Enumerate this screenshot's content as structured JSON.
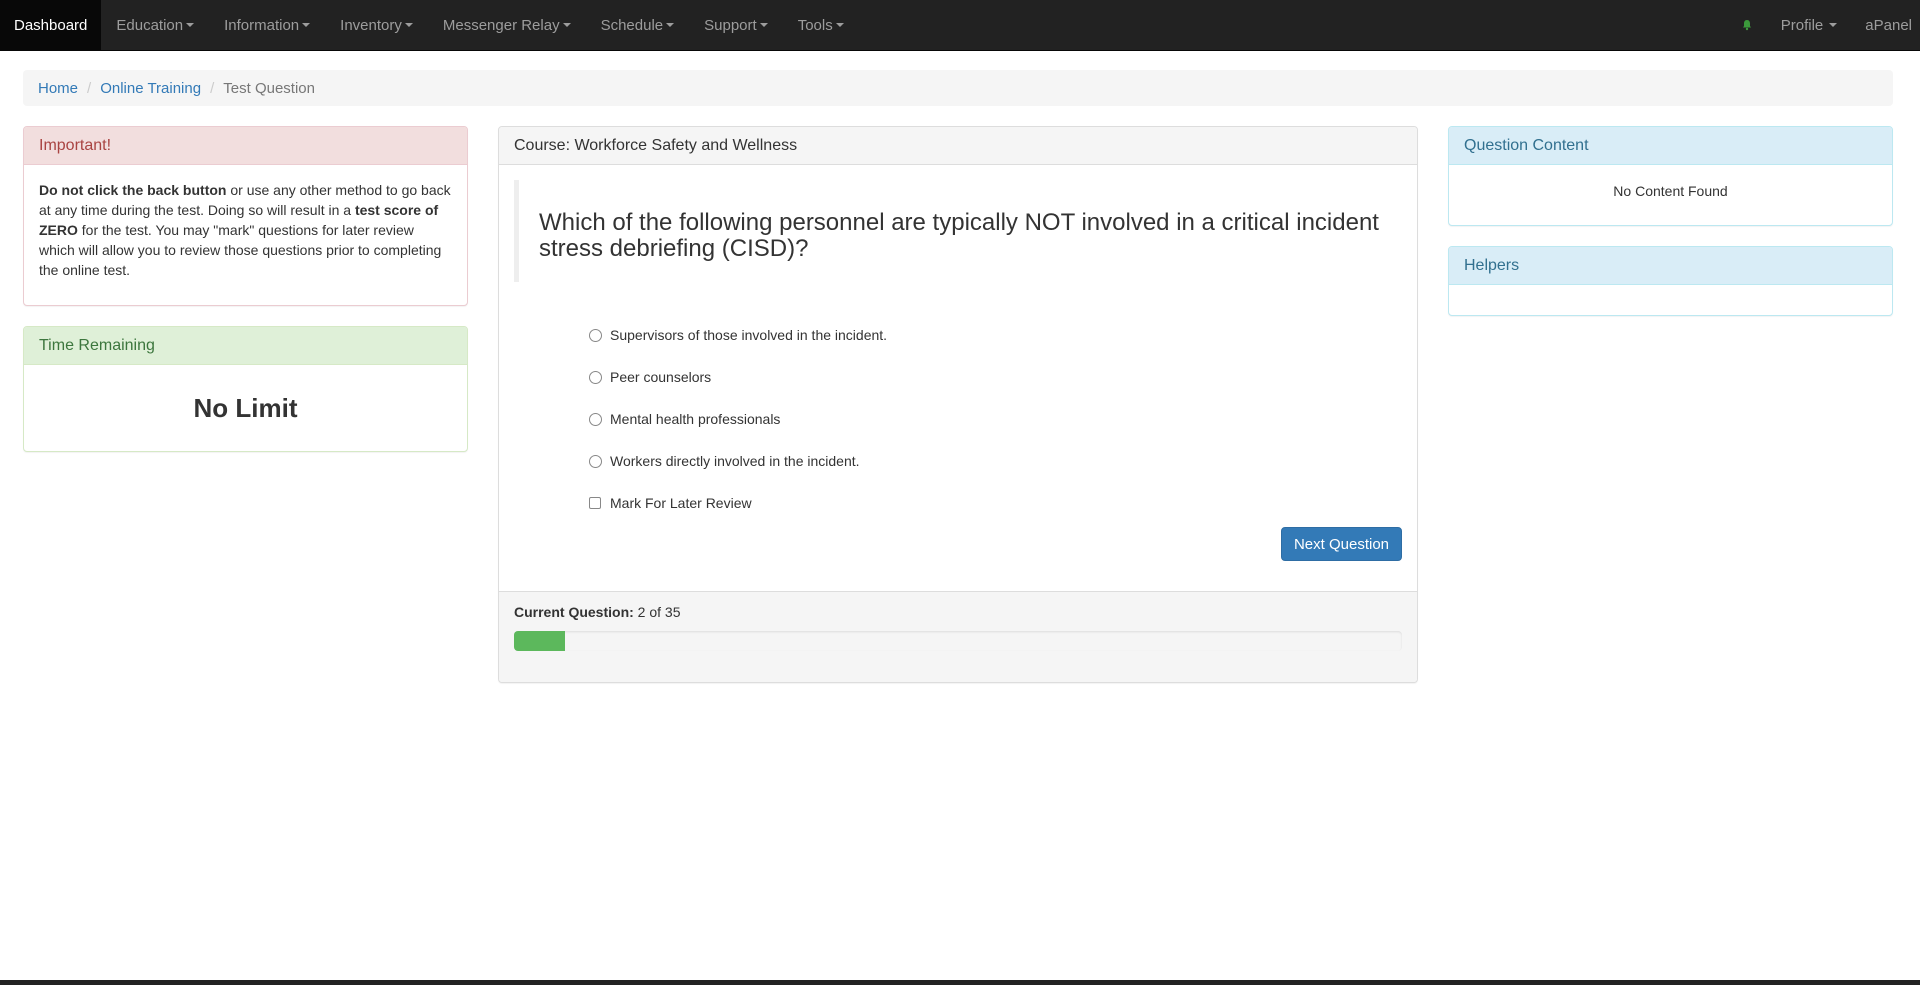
{
  "navbar": {
    "brand": "Dashboard",
    "menus": [
      {
        "label": "Education"
      },
      {
        "label": "Information"
      },
      {
        "label": "Inventory"
      },
      {
        "label": "Messenger Relay"
      },
      {
        "label": "Schedule"
      },
      {
        "label": "Support"
      },
      {
        "label": "Tools"
      }
    ],
    "bell_icon": "bell-icon",
    "bell_color": "#3c9a3c",
    "profile_label": "Profile",
    "apanel_label": "aPanel"
  },
  "breadcrumb": {
    "items": [
      "Home",
      "Online Training"
    ],
    "current": "Test Question"
  },
  "important": {
    "heading": "Important!",
    "bold1": "Do not click the back button",
    "text1": " or use any other method to go back at any time during the test. Doing so will result in a ",
    "bold2": "test score of ZERO",
    "text2": " for the test. You may \"mark\" questions for later review which will allow you to review those questions prior to completing the online test."
  },
  "time_remaining": {
    "heading": "Time Remaining",
    "value": "No Limit"
  },
  "course": {
    "heading": "Course: Workforce Safety and Wellness",
    "question": "Which of the following personnel are typically NOT involved in a critical incident stress debriefing (CISD)?",
    "answers": [
      "Supervisors of those involved in the incident.",
      "Peer counselors",
      "Mental health professionals",
      "Workers directly involved in the incident."
    ],
    "mark_review_label": "Mark For Later Review",
    "next_button": "Next Question",
    "current_question_label": "Current Question:",
    "current_question_value": "2 of 35",
    "progress_fraction": 0.057
  },
  "question_content": {
    "heading": "Question Content",
    "body": "No Content Found"
  },
  "helpers": {
    "heading": "Helpers"
  }
}
